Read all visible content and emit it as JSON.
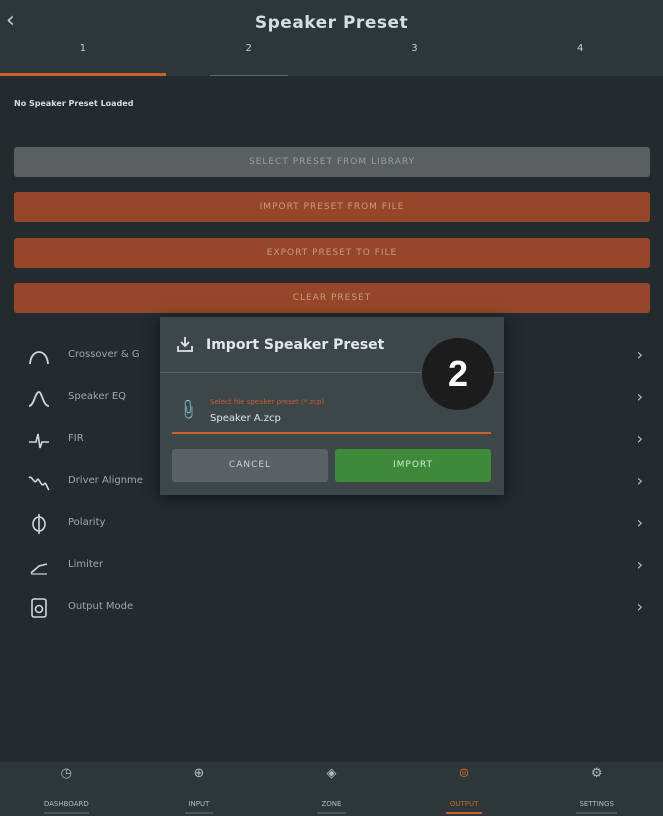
{
  "header": {
    "title": "Speaker Preset",
    "tabs": [
      {
        "label": "1"
      },
      {
        "label": "2"
      },
      {
        "label": "3"
      },
      {
        "label": "4"
      }
    ]
  },
  "status_text": "No Speaker Preset Loaded",
  "buttons": {
    "select_library": "SELECT PRESET FROM LIBRARY",
    "import_file": "IMPORT PRESET FROM FILE",
    "export_file": "EXPORT PRESET TO FILE",
    "clear": "CLEAR PRESET"
  },
  "menu": [
    {
      "label": "Crossover & G",
      "icon": "crossover-icon"
    },
    {
      "label": "Speaker EQ",
      "icon": "eq-icon"
    },
    {
      "label": "FIR",
      "icon": "fir-icon"
    },
    {
      "label": "Driver Alignme",
      "icon": "driver-alignment-icon"
    },
    {
      "label": "Polarity",
      "icon": "polarity-icon"
    },
    {
      "label": "Limiter",
      "icon": "limiter-icon"
    },
    {
      "label": "Output Mode",
      "icon": "output-mode-icon"
    }
  ],
  "dialog": {
    "title": "Import Speaker Preset",
    "field_label": "Select file speaker preset (*.zcp)",
    "field_value": "Speaker A.zcp",
    "cancel": "CANCEL",
    "import": "IMPORT"
  },
  "step_badge": "2",
  "bottom_nav": [
    {
      "label": "DASHBOARD",
      "icon": "dashboard-icon"
    },
    {
      "label": "INPUT",
      "icon": "input-icon"
    },
    {
      "label": "ZONE",
      "icon": "zone-icon"
    },
    {
      "label": "OUTPUT",
      "icon": "output-icon"
    },
    {
      "label": "SETTINGS",
      "icon": "settings-icon"
    }
  ],
  "colors": {
    "accent": "#c7622f",
    "background": "#232b2d",
    "import_button": "#3e8a3a"
  }
}
